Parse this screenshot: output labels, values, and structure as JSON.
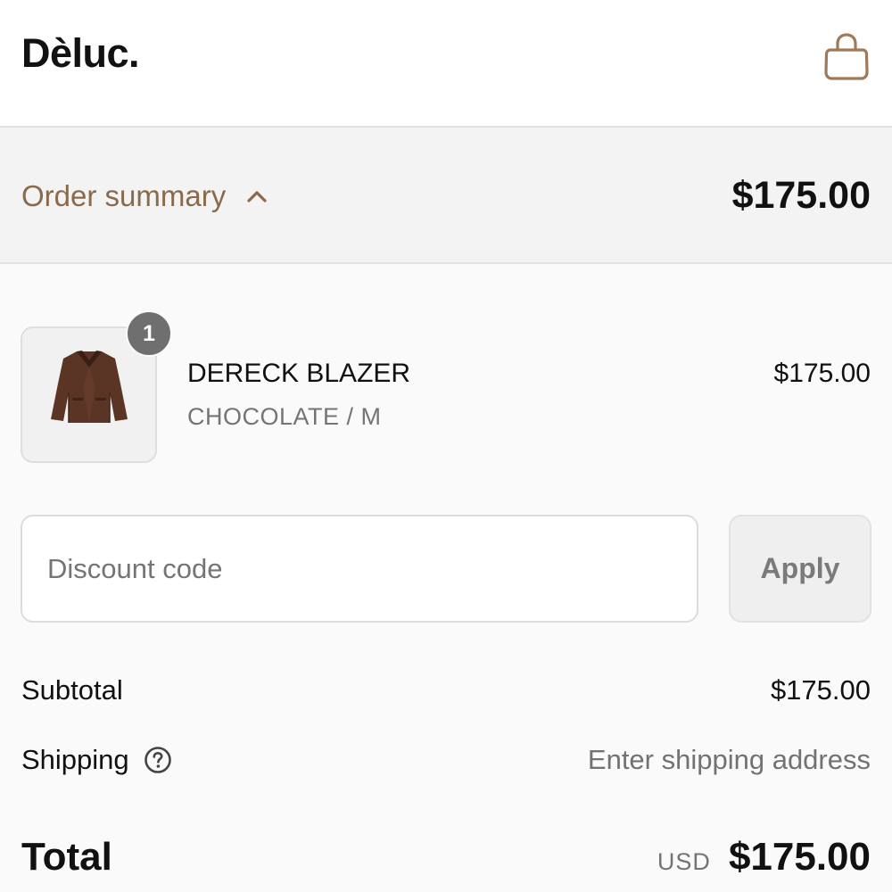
{
  "header": {
    "logo": "Dèluc.",
    "cart_icon": "shopping-bag-icon",
    "accent_color": "#a07a58"
  },
  "summary": {
    "toggle_label": "Order summary",
    "toggle_icon": "chevron-up-icon",
    "total": "$175.00"
  },
  "cart": {
    "items": [
      {
        "quantity": "1",
        "name": "DERECK BLAZER",
        "variant": "CHOCOLATE / M",
        "price": "$175.00",
        "image": "brown-blazer-thumbnail"
      }
    ]
  },
  "discount": {
    "placeholder": "Discount code",
    "value": "",
    "apply_label": "Apply"
  },
  "totals": {
    "subtotal_label": "Subtotal",
    "subtotal_value": "$175.00",
    "shipping_label": "Shipping",
    "shipping_icon": "help-circle-icon",
    "shipping_value": "Enter shipping address",
    "total_label": "Total",
    "currency": "USD",
    "total_value": "$175.00"
  }
}
